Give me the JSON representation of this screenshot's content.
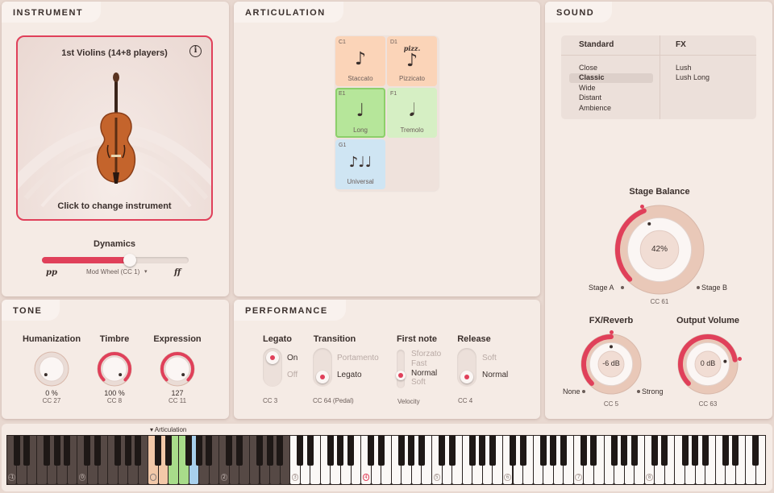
{
  "instrument": {
    "tab": "INSTRUMENT",
    "name": "1st Violins (14+8 players)",
    "change_label": "Click to change instrument",
    "info_glyph": "i",
    "dynamics": {
      "label": "Dynamics",
      "min_label": "pp",
      "max_label": "ff",
      "source": "Mod Wheel (CC 1)",
      "value": 0.6
    }
  },
  "tone": {
    "tab": "TONE",
    "knobs": [
      {
        "label": "Humanization",
        "value": "0 %",
        "cc": "CC 27",
        "fraction": 0.0
      },
      {
        "label": "Timbre",
        "value": "100 %",
        "cc": "CC 8",
        "fraction": 1.0
      },
      {
        "label": "Expression",
        "value": "127",
        "cc": "CC 11",
        "fraction": 1.0
      }
    ]
  },
  "articulation": {
    "tab": "ARTICULATION",
    "cells": [
      {
        "key": "C1",
        "name": "Staccato",
        "glyph": "♪",
        "color": "#fbd4b8",
        "extra": ""
      },
      {
        "key": "D1",
        "name": "Pizzicato",
        "glyph": "♪",
        "color": "#fbd4b8",
        "extra": "pizz."
      },
      {
        "key": "E1",
        "name": "Long",
        "glyph": "♩",
        "color": "#b6e69a",
        "extra": ""
      },
      {
        "key": "F1",
        "name": "Tremolo",
        "glyph": "𝅘𝅥",
        "color": "#d6efc4",
        "extra": ""
      },
      {
        "key": "G1",
        "name": "Universal",
        "glyph": "♪♩♩",
        "color": "#cfe5f3",
        "extra": ""
      }
    ]
  },
  "performance": {
    "tab": "PERFORMANCE",
    "legato": {
      "label": "Legato",
      "on": "On",
      "off": "Off",
      "cc": "CC 3",
      "state": "On"
    },
    "transition": {
      "label": "Transition",
      "option1": "Portamento",
      "option2": "Legato",
      "cc": "CC 64 (Pedal)",
      "state": "Legato"
    },
    "first_note": {
      "label": "First note",
      "options": [
        "Sforzato",
        "Fast",
        "Normal",
        "Soft"
      ],
      "selected": "Normal",
      "source": "Velocity"
    },
    "release": {
      "label": "Release",
      "option1": "Soft",
      "option2": "Normal",
      "cc": "CC 4",
      "state": "Normal"
    }
  },
  "sound": {
    "tab": "SOUND",
    "standard": {
      "header": "Standard",
      "items": [
        "Close",
        "Classic",
        "Wide",
        "Distant",
        "Ambience"
      ],
      "selected": "Classic"
    },
    "fx": {
      "header": "FX",
      "items": [
        "Lush",
        "Lush Long"
      ]
    },
    "stage_balance": {
      "label": "Stage Balance",
      "value": "42%",
      "cc": "CC 61",
      "left": "Stage A",
      "right": "Stage B",
      "fraction": 0.42
    },
    "fx_reverb": {
      "label": "FX/Reverb",
      "value": "-6 dB",
      "cc": "CC 5",
      "left": "None",
      "right": "Strong",
      "fraction": 0.5
    },
    "output_volume": {
      "label": "Output Volume",
      "value": "0 dB",
      "cc": "CC 63",
      "fraction": 0.8
    }
  },
  "keyboard": {
    "articulation_marker": "▾ Articulation",
    "octave_labels": [
      "-1",
      "0",
      "1",
      "2",
      "3",
      "4",
      "5",
      "6",
      "7",
      "8"
    ],
    "colors": {
      "orange": "#f2c8a8",
      "green": "#a8dc8a",
      "blue": "#a8d0ec",
      "accent": "#e0405a"
    }
  }
}
